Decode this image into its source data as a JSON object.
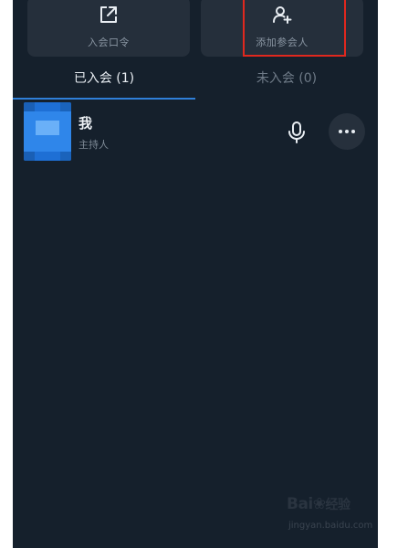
{
  "actions": {
    "join_code_label": "入会口令",
    "add_participant_label": "添加参会人"
  },
  "tabs": {
    "joined_label": "已入会 (1)",
    "not_joined_label": "未入会 (0)"
  },
  "participant": {
    "name": "我",
    "role": "主持人"
  },
  "icons": {
    "share": "share-icon",
    "add_user": "add-user-icon",
    "mic": "microphone-icon",
    "more": "more-dots-icon"
  },
  "colors": {
    "background": "#15202c",
    "accent": "#2f7fd8",
    "highlight": "#e0281e"
  },
  "watermark": {
    "logo": "Bai",
    "suffix": "经验",
    "url": "jingyan.baidu.com"
  }
}
